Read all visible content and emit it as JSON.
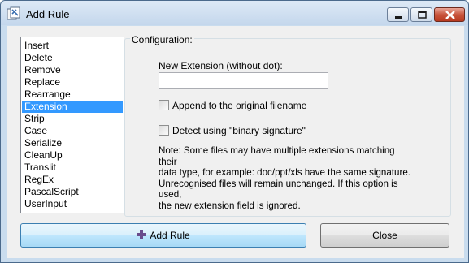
{
  "window": {
    "title": "Add Rule"
  },
  "rules": {
    "items": [
      "Insert",
      "Delete",
      "Remove",
      "Replace",
      "Rearrange",
      "Extension",
      "Strip",
      "Case",
      "Serialize",
      "CleanUp",
      "Translit",
      "RegEx",
      "PascalScript",
      "UserInput"
    ],
    "selected": "Extension"
  },
  "config": {
    "caption": "Configuration:",
    "new_extension_label": "New Extension (without dot):",
    "new_extension_value": "",
    "append_label": "Append to the original filename",
    "append_checked": false,
    "detect_label": "Detect using \"binary signature\"",
    "detect_checked": false,
    "note_lines": [
      "Note: Some files may have multiple extensions matching their",
      "data type, for example: doc/ppt/xls have the same signature.",
      "Unrecognised files will remain unchanged. If this option is used,",
      "the new extension field is ignored."
    ]
  },
  "buttons": {
    "add_rule": "Add Rule",
    "close": "Close"
  },
  "colors": {
    "selection": "#3399ff",
    "accent_plus": "#6a4c8c"
  }
}
